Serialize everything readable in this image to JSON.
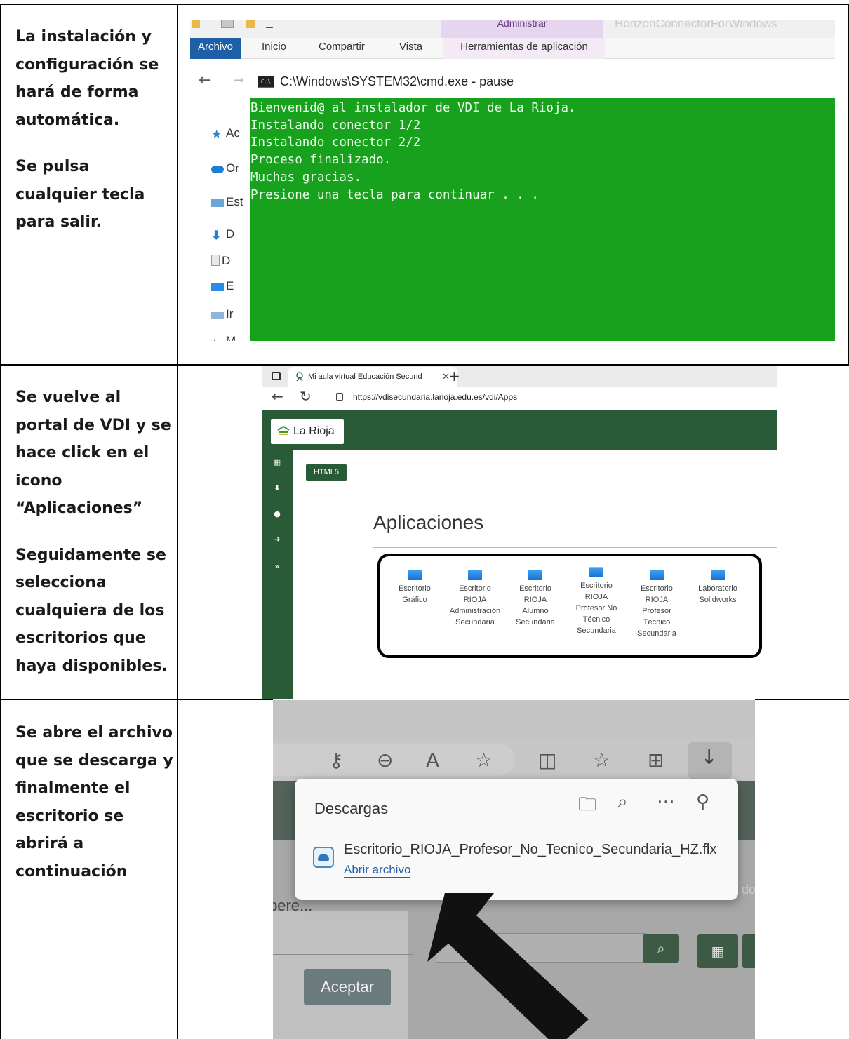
{
  "rows": [
    {
      "instructions": [
        "La instalación y configuración se hará de forma automática.",
        "Se pulsa cualquier tecla para salir."
      ]
    },
    {
      "instructions": [
        "Se vuelve al portal de VDI y se hace click en el icono “Aplicaciones”",
        "Seguidamente se selecciona cualquiera de los escritorios que haya disponibles."
      ]
    },
    {
      "instructions": [
        "Se abre el archivo que se descarga y finalmente el escritorio se abrirá a continuación"
      ]
    }
  ],
  "explorer": {
    "context_group": "Administrar",
    "window_title": "HorizonConnectorForWindows",
    "tabs": [
      "Archivo",
      "Inicio",
      "Compartir",
      "Vista",
      "Herramientas de aplicación"
    ],
    "side_items": [
      "Ac",
      "Or",
      "Est",
      "D",
      "D",
      "E",
      "Ir",
      "M"
    ]
  },
  "cmd": {
    "title": "C:\\Windows\\SYSTEM32\\cmd.exe - pause",
    "icon_label": "C:\\",
    "lines": [
      "Bienvenid@ al instalador de VDI de La Rioja.",
      "Instalando conector 1/2",
      "Instalando conector 2/2",
      "Proceso finalizado.",
      "Muchas gracias.",
      "Presione una tecla para continuar . . ."
    ],
    "background_color": "#17a11c"
  },
  "browser": {
    "tab_title": "Mi aula virtual Educación Secund",
    "url": "https://vdisecundaria.larioja.edu.es/vdi/Apps",
    "logo_text": "La Rioja",
    "html5_label": "HTML5",
    "section_title": "Aplicaciones",
    "apps": [
      {
        "lines": [
          "Escritorio",
          "Gráfico"
        ]
      },
      {
        "lines": [
          "Escritorio",
          "RIOJA",
          "Administración",
          "Secundaria"
        ]
      },
      {
        "lines": [
          "Escritorio",
          "RIOJA",
          "Alumno",
          "Secundaria"
        ]
      },
      {
        "lines": [
          "Escritorio",
          "RIOJA",
          "Profesor No",
          "Técnico",
          "Secundaria"
        ]
      },
      {
        "lines": [
          "Escritorio",
          "RIOJA",
          "Profesor",
          "Técnico",
          "Secundaria"
        ]
      },
      {
        "lines": [
          "Laboratorio",
          "Solidworks"
        ]
      }
    ],
    "accent_color": "#285b36"
  },
  "downloads": {
    "title": "Descargas",
    "file_name": "Escritorio_RIOJA_Profesor_No_Tecnico_Secundaria_HZ.flx",
    "open_link": "Abrir archivo",
    "background_fragment": "pere...",
    "side_fragment": "do",
    "accept_button": "Aceptar"
  }
}
